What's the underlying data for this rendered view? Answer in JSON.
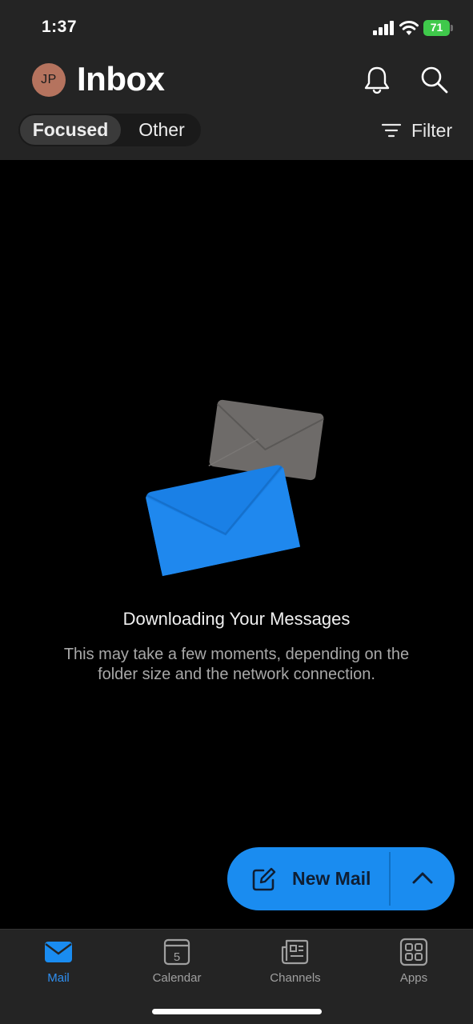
{
  "status_bar": {
    "time": "1:37",
    "battery_level": "71",
    "icons": [
      "cellular-signal-icon",
      "wifi-icon",
      "battery-charging-icon"
    ]
  },
  "header": {
    "avatar_initials": "JP",
    "title": "Inbox",
    "icons": [
      "bell-icon",
      "search-icon"
    ]
  },
  "tabs_segment": {
    "focused_label": "Focused",
    "other_label": "Other",
    "selected": "Focused"
  },
  "filter": {
    "label": "Filter",
    "icon": "filter-lines-icon"
  },
  "empty_state": {
    "title": "Downloading Your Messages",
    "subtitle": "This may take a few moments, depending on the folder size and the network connection.",
    "illustration": "envelopes-illustration"
  },
  "fab": {
    "label": "New Mail",
    "icons": [
      "compose-icon",
      "chevron-up-icon"
    ]
  },
  "bottom_nav": {
    "items": [
      {
        "label": "Mail",
        "icon": "mail-icon",
        "active": true
      },
      {
        "label": "Calendar",
        "icon": "calendar-icon",
        "badge": "5"
      },
      {
        "label": "Channels",
        "icon": "channels-icon"
      },
      {
        "label": "Apps",
        "icon": "apps-grid-icon"
      }
    ]
  },
  "colors": {
    "accent": "#1a8cf0",
    "header_bg": "#242424",
    "background": "#000000",
    "avatar": "#b5735e",
    "battery": "#3fc94b"
  }
}
